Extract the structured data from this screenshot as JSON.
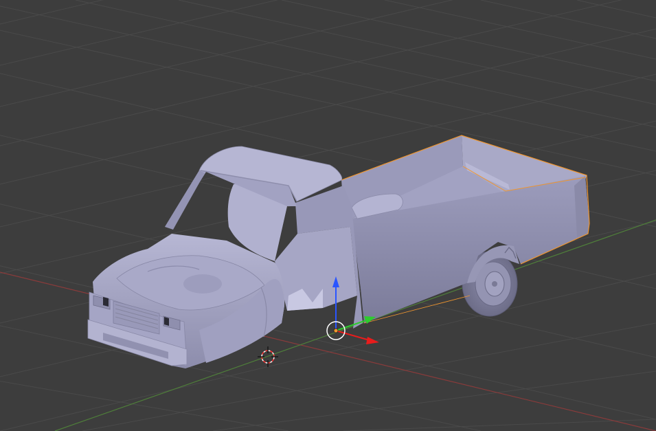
{
  "viewport": {
    "mode": "solid-shaded",
    "background_color": "#3d3d3d",
    "grid_color": "#4a4a4a",
    "x_axis_color": "#8a3b3b",
    "y_axis_color": "#4f7f3a",
    "selection_outline_color": "#f0962f",
    "model_color": "#a8a8c8"
  },
  "scene_object": {
    "name": "pickup-truck",
    "selected": true
  },
  "gizmo": {
    "x_axis_color": "#e81c1c",
    "y_axis_color": "#2ecc2e",
    "z_axis_color": "#2a55ff",
    "icon": "translate-gizmo-icon"
  },
  "cursor_3d": {
    "icon": "3d-cursor-icon"
  }
}
